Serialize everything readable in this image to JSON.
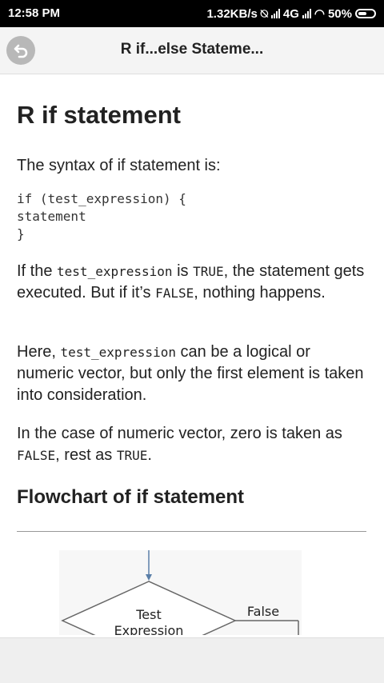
{
  "status": {
    "time": "12:58 PM",
    "speed": "1.32KB/s",
    "network": "4G",
    "battery": "50%"
  },
  "appbar": {
    "title": "R if...else Stateme..."
  },
  "article": {
    "heading": "R if statement",
    "intro": "The syntax of if statement is:",
    "code": [
      "if (test_expression) {",
      "statement",
      "}"
    ],
    "p1": {
      "a": "If the ",
      "code1": "test_expression",
      "b": " is ",
      "code2": "TRUE",
      "c": ", the statement gets executed. But if it’s ",
      "code3": "FALSE",
      "d": ", nothing happens."
    },
    "p2": {
      "a": "Here, ",
      "code1": "test_expression",
      "b": " can be a logical or numeric vector, but only the first element is taken into consideration."
    },
    "p3": {
      "a": "In the case of numeric vector, zero is taken as ",
      "code1": "FALSE",
      "b": ", rest as ",
      "code2": "TRUE",
      "c": "."
    },
    "subheading": "Flowchart of if statement",
    "flowchart": {
      "label_test_1": "Test",
      "label_test_2": "Expression",
      "label_false": "False"
    }
  }
}
